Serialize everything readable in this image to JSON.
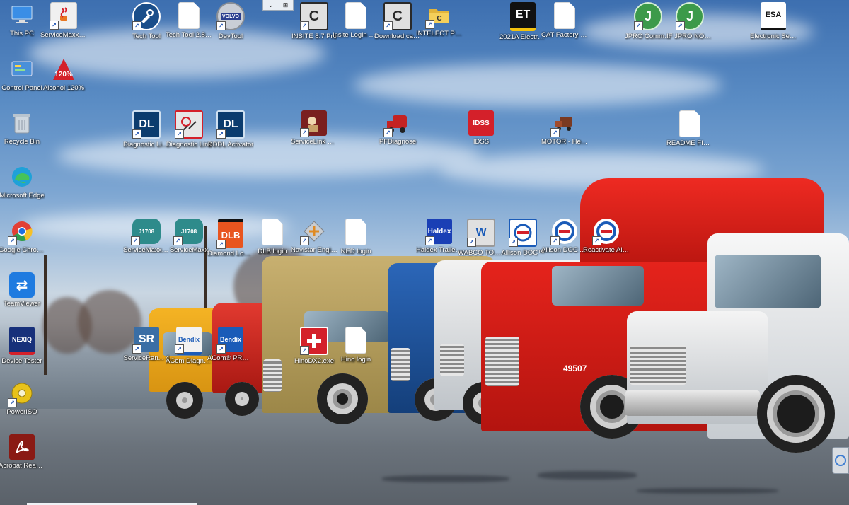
{
  "desktop": {
    "icons": [
      {
        "label": "This PC",
        "icon": "this-pc-icon",
        "color": "#3a8ee6"
      },
      {
        "label": "ServiceMaxx J1939&J17...",
        "icon": "java-icon",
        "color": "#f0f0f0"
      },
      {
        "label": "Tech Tool",
        "icon": "tech-tool-icon",
        "color": "#1a4e8a"
      },
      {
        "label": "Tech Tool 2.8 Login",
        "icon": "document-icon",
        "color": "#ffffff"
      },
      {
        "label": "DevTool",
        "icon": "volvo-icon",
        "color": "#2b3f8f"
      },
      {
        "label": "INSITE 8.7 Pro",
        "icon": "insite-icon",
        "color": "#2a2a2a"
      },
      {
        "label": "Insite Login & instructions",
        "icon": "document-icon",
        "color": "#ffffff"
      },
      {
        "label": "Download cals only !",
        "icon": "insite-icon",
        "color": "#2a2a2a"
      },
      {
        "label": "INTELECT Programs",
        "icon": "folder-icon",
        "color": "#e2b43a"
      },
      {
        "label": "2021A Electroni...",
        "icon": "cat-et-icon",
        "color": "#111111"
      },
      {
        "label": "CAT Factory Password",
        "icon": "document-icon",
        "color": "#ffffff"
      },
      {
        "label": "JPRO Commerci...",
        "icon": "jpro-icon",
        "color": "#3c9a4a"
      },
      {
        "label": "IF JPRO NOT WORKING",
        "icon": "jpro-icon",
        "color": "#3c9a4a"
      },
      {
        "label": "Electronic Service ...",
        "icon": "esa-icon",
        "color": "#ffffff"
      },
      {
        "label": "Control Panel",
        "icon": "control-panel-icon",
        "color": "#4a90d9"
      },
      {
        "label": "Alcohol 120%",
        "icon": "alcohol-icon",
        "color": "#d4202a"
      },
      {
        "label": "Recycle Bin",
        "icon": "recycle-bin-icon",
        "color": "#cfd8e0"
      },
      {
        "label": "Diagnostic Link 8",
        "icon": "dl8-icon",
        "color": "#0b3c6e"
      },
      {
        "label": "Diagnostic Link",
        "icon": "diagnostic-link-icon",
        "color": "#e6e6e6"
      },
      {
        "label": "DDDL Activator",
        "icon": "dl8-icon",
        "color": "#0b3c6e"
      },
      {
        "label": "ServiceLink Offline",
        "icon": "servicelink-icon",
        "color": "#7a1f1f"
      },
      {
        "label": "PFDiagnose",
        "icon": "truck-icon",
        "color": "#c42222"
      },
      {
        "label": "IDSS",
        "icon": "idss-icon",
        "color": "#d4202a"
      },
      {
        "label": "MOTOR - Heavy Truc...",
        "icon": "truck-icon",
        "color": "#7a3a22"
      },
      {
        "label": "README FIRST",
        "icon": "document-icon",
        "color": "#ffffff"
      },
      {
        "label": "Microsoft Edge",
        "icon": "edge-icon",
        "color": "#1fa1d8"
      },
      {
        "label": "Google Chrome",
        "icon": "chrome-icon",
        "color": "#e23f35"
      },
      {
        "label": "ServiceMaxx J1708",
        "icon": "engine-icon",
        "color": "#2e8b8b"
      },
      {
        "label": "ServiceMaxx",
        "icon": "engine-icon",
        "color": "#2e8b8b"
      },
      {
        "label": "Diamond Logic Builder",
        "icon": "dlb-icon",
        "color": "#e8551f"
      },
      {
        "label": "DLB login",
        "icon": "document-icon",
        "color": "#ffffff"
      },
      {
        "label": "Navistar Engine Di...",
        "icon": "navistar-icon",
        "color": "#b0b0b0"
      },
      {
        "label": "NED login",
        "icon": "document-icon",
        "color": "#ffffff"
      },
      {
        "label": "Haldex Trailer AB...",
        "icon": "haldex-icon",
        "color": "#1a3fb5"
      },
      {
        "label": "WABCO TOOLBOX",
        "icon": "wabco-icon",
        "color": "#e0e0e0"
      },
      {
        "label": "Allison DOC™",
        "icon": "allison-icon",
        "color": "#ffffff"
      },
      {
        "label": "Allison DOC Advanced ...",
        "icon": "allison-icon",
        "color": "#ffffff"
      },
      {
        "label": "Reactivate Allison",
        "icon": "allison-icon",
        "color": "#ffffff"
      },
      {
        "label": "TeamViewer",
        "icon": "teamviewer-icon",
        "color": "#1f7be0"
      },
      {
        "label": "Device Tester",
        "icon": "nexiq-icon",
        "color": "#17307a"
      },
      {
        "label": "ServiceRan... 4",
        "icon": "sr-icon",
        "color": "#3a6ea5"
      },
      {
        "label": "ACom Diagnostics",
        "icon": "bendix-icon",
        "color": "#f2f2f2"
      },
      {
        "label": "ACom® PRO™ Dia...",
        "icon": "bendix-icon",
        "color": "#1a5bb8"
      },
      {
        "label": "HinoDX2.exe",
        "icon": "hino-icon",
        "color": "#d4202a"
      },
      {
        "label": "Hino login",
        "icon": "document-icon",
        "color": "#ffffff"
      },
      {
        "label": "PowerISO",
        "icon": "poweriso-icon",
        "color": "#e8c21a"
      },
      {
        "label": "Acrobat Reader DC",
        "icon": "acrobat-icon",
        "color": "#8a1a14"
      }
    ],
    "icon_text": {
      "tech_tool": "",
      "insite": "C",
      "cat_et": "ET",
      "jpro": "J",
      "esa": "ESA",
      "alcohol": "120%",
      "dl": "DL",
      "idss": "IDSS",
      "dlb": "DLB",
      "haldex": "Haldex",
      "wabco": "W",
      "teamviewer": "⇄",
      "nexiq": "NEXIQ",
      "sr": "SR",
      "bendix": "Bendix",
      "volvo": "VOLVO",
      "engine": "J1708"
    },
    "wallpaper": {
      "fleet_number": "49507"
    }
  }
}
